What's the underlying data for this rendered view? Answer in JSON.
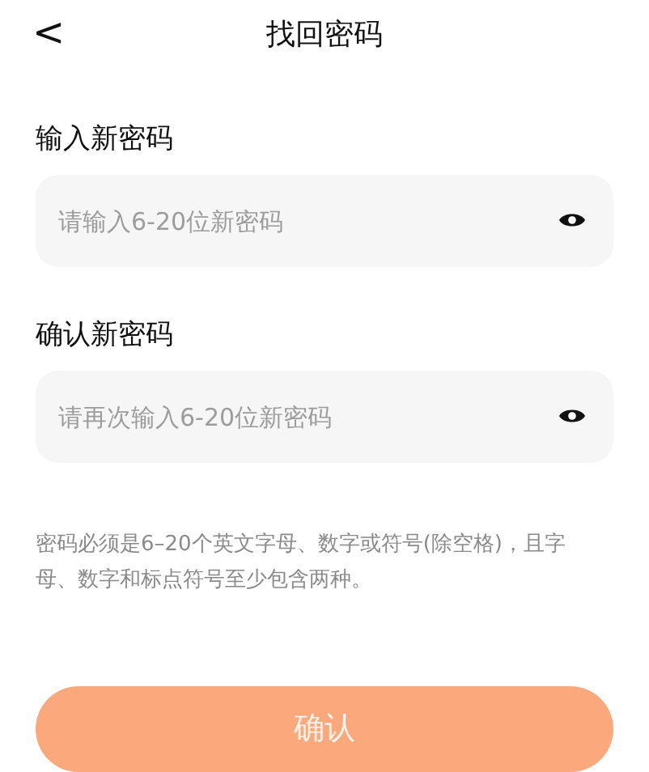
{
  "header": {
    "back": "<",
    "title": "找回密码"
  },
  "fields": [
    {
      "label": "输入新密码",
      "placeholder": "请输入6-20位新密码"
    },
    {
      "label": "确认新密码",
      "placeholder": "请再次输入6-20位新密码"
    }
  ],
  "hint": "密码必须是6–20个英文字母、数字或符号(除空格)，且字母、数字和标点符号至少包含两种。",
  "submit": {
    "label": "确认",
    "disabled": true
  }
}
